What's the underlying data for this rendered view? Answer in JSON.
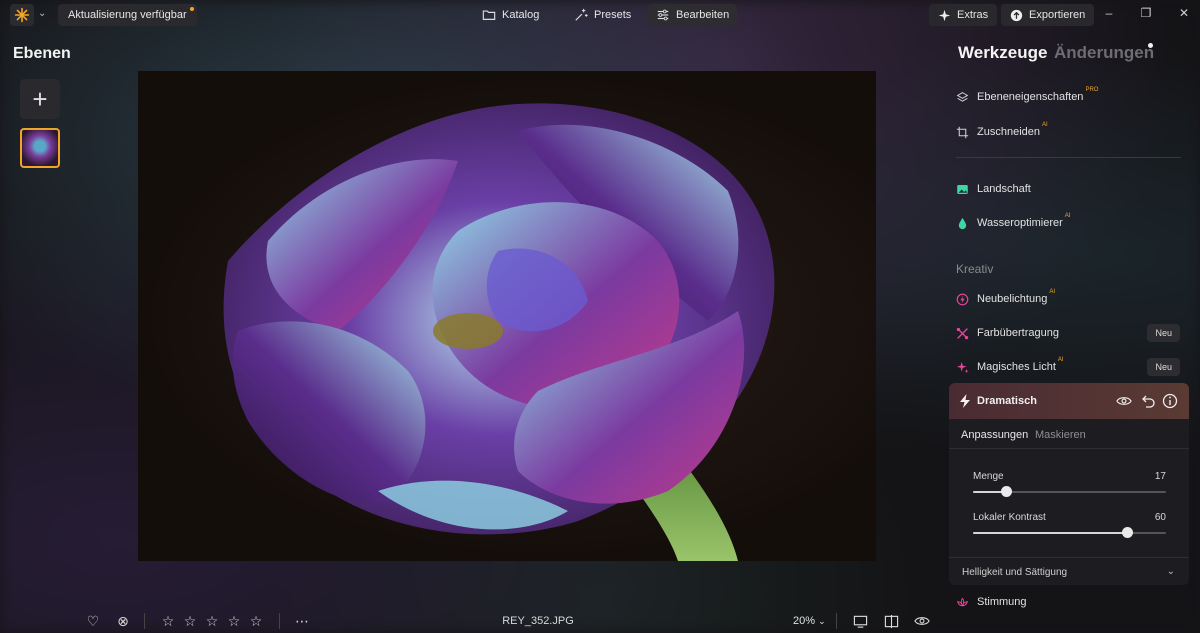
{
  "topbar": {
    "update_label": "Aktualisierung verfügbar",
    "nav": [
      {
        "label": "Katalog",
        "icon": "folder-icon",
        "active": false
      },
      {
        "label": "Presets",
        "icon": "sparkle-wand-icon",
        "active": false
      },
      {
        "label": "Bearbeiten",
        "icon": "sliders-icon",
        "active": true
      }
    ],
    "extras_label": "Extras",
    "export_label": "Exportieren",
    "accent": "#f5a623"
  },
  "left_panel": {
    "title": "Ebenen",
    "add_label": "+"
  },
  "bottom_bar": {
    "filename": "REY_352.JPG",
    "zoom": "20%",
    "rating": 0,
    "rating_max": 5
  },
  "right_panel": {
    "tabs": [
      {
        "label": "Werkzeuge",
        "active": true
      },
      {
        "label": "Änderungen",
        "active": false
      }
    ],
    "tools_top": [
      {
        "label": "Ebeneneigenschaften",
        "tag": "PRO",
        "icon": "layers-icon",
        "color": "#d0d0d0"
      },
      {
        "label": "Zuschneiden",
        "tag": "AI",
        "icon": "crop-icon",
        "color": "#d0d0d0"
      }
    ],
    "tools_mid": [
      {
        "label": "Landschaft",
        "tag": "",
        "icon": "landscape-icon",
        "color": "#3fd6a6"
      },
      {
        "label": "Wasseroptimierer",
        "tag": "AI",
        "icon": "water-drop-icon",
        "color": "#3fd6a6"
      }
    ],
    "section_kreativ": "Kreativ",
    "tools_creative": [
      {
        "label": "Neubelichtung",
        "tag": "AI",
        "badge": "",
        "icon": "relight-icon",
        "color": "#e9459a"
      },
      {
        "label": "Farbübertragung",
        "tag": "",
        "badge": "Neu",
        "icon": "color-transfer-icon",
        "color": "#e9459a"
      },
      {
        "label": "Magisches Licht",
        "tag": "AI",
        "badge": "Neu",
        "icon": "magic-light-icon",
        "color": "#e9459a"
      }
    ],
    "dramatic": {
      "title": "Dramatisch",
      "subtabs": [
        "Anpassungen",
        "Maskieren"
      ],
      "sliders": [
        {
          "label": "Menge",
          "value": 17,
          "min": 0,
          "max": 100
        },
        {
          "label": "Lokaler Kontrast",
          "value": 60,
          "min": -100,
          "max": 100
        }
      ],
      "collapsed_section": "Helligkeit und Sättigung"
    },
    "tools_after": [
      {
        "label": "Stimmung",
        "icon": "mood-lotus-icon",
        "color": "#e9459a"
      }
    ]
  }
}
